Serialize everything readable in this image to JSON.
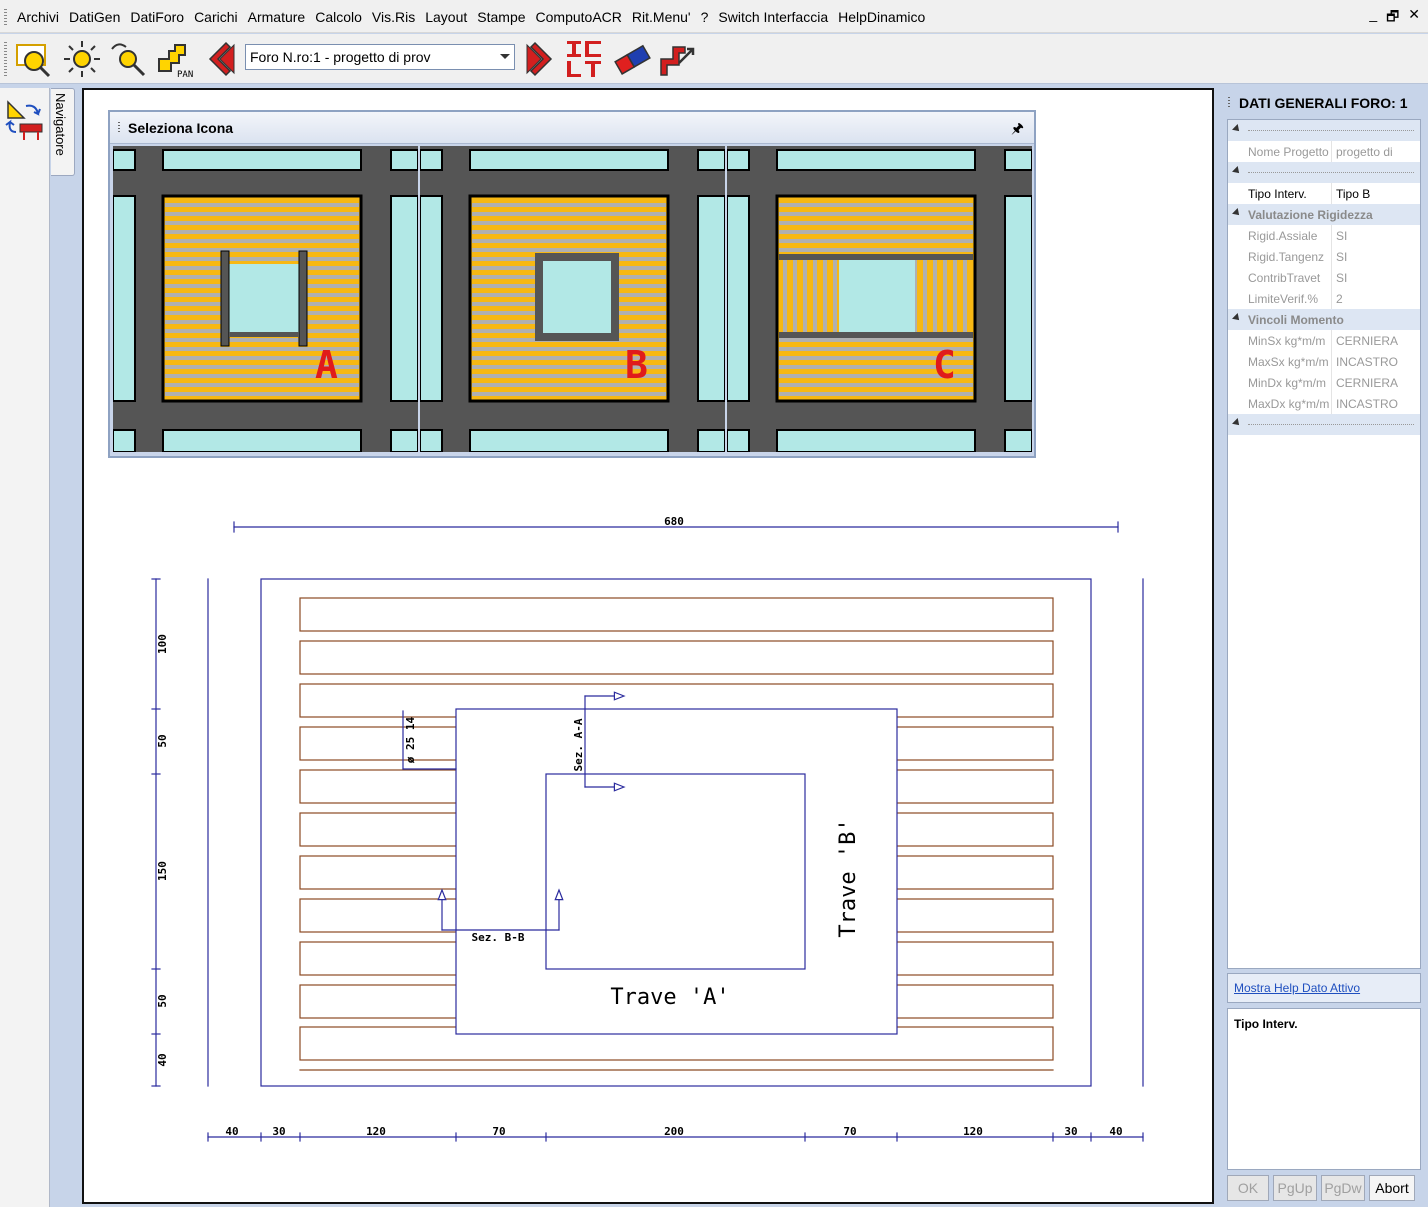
{
  "menu": [
    "Archivi",
    "DatiGen",
    "DatiForo",
    "Carichi",
    "Armature",
    "Calcolo",
    "Vis.Ris",
    "Layout",
    "Stampe",
    "ComputoACR",
    "Rit.Menu'",
    "?",
    "Switch Interfaccia",
    "HelpDinamico"
  ],
  "window_controls": {
    "minimize": "_",
    "restore": "🗗",
    "close": "✕"
  },
  "toolbar": {
    "combo_value": "Foro N.ro:1 - progetto di prov",
    "icons": [
      "select-zoom-icon",
      "zoom-all-icon",
      "zoom-icon",
      "pan-icon",
      "previous-icon",
      "next-icon",
      "section-icon",
      "eraser-icon",
      "redraw-icon"
    ],
    "pan_label": "PAN"
  },
  "navigator_tab": "Navigatore",
  "icon_selector": {
    "title": "Seleziona Icona",
    "pin": "🖈",
    "options": [
      {
        "letter": "A"
      },
      {
        "letter": "B"
      },
      {
        "letter": "C"
      }
    ]
  },
  "drawing": {
    "overall_dim": "680",
    "section_a": "Sez. A-A",
    "section_b": "Sez. B-B",
    "beam_a": "Trave 'A'",
    "beam_b": "Trave 'B'",
    "bar_label": "ø 25 14",
    "vertical_dims": [
      "100",
      "50",
      "150",
      "50",
      "40"
    ],
    "horizontal_dims": [
      "40",
      "30",
      "120",
      "70",
      "200",
      "70",
      "120",
      "30",
      "40"
    ]
  },
  "properties": {
    "title": "DATI GENERALI FORO: 1",
    "rows": [
      {
        "type": "sep"
      },
      {
        "type": "prop",
        "key": "Nome Progetto",
        "value": "progetto di"
      },
      {
        "type": "sep"
      },
      {
        "type": "prop",
        "key": "Tipo Interv.",
        "value": "Tipo B",
        "active": true
      },
      {
        "type": "cat",
        "label": "Valutazione Rigidezza"
      },
      {
        "type": "prop",
        "key": "Rigid.Assiale",
        "value": "SI"
      },
      {
        "type": "prop",
        "key": "Rigid.Tangenz",
        "value": "SI"
      },
      {
        "type": "prop",
        "key": "ContribTravet",
        "value": "SI"
      },
      {
        "type": "prop",
        "key": "LimiteVerif.%",
        "value": "2"
      },
      {
        "type": "cat",
        "label": "Vincoli Momento"
      },
      {
        "type": "prop",
        "key": "MinSx kg*m/m",
        "value": "CERNIERA"
      },
      {
        "type": "prop",
        "key": "MaxSx kg*m/m",
        "value": "INCASTRO"
      },
      {
        "type": "prop",
        "key": "MinDx kg*m/m",
        "value": "CERNIERA"
      },
      {
        "type": "prop",
        "key": "MaxDx kg*m/m",
        "value": "INCASTRO"
      },
      {
        "type": "sep"
      }
    ],
    "help_link": "Mostra Help Dato Attivo",
    "help_title": "Tipo Interv.",
    "buttons": [
      {
        "label": "OK",
        "enabled": false
      },
      {
        "label": "PgUp",
        "enabled": false
      },
      {
        "label": "PgDw",
        "enabled": false
      },
      {
        "label": "Abort",
        "enabled": true
      }
    ]
  },
  "colors": {
    "dark": "#555555",
    "cyan": "#b2e8e6",
    "orange": "#f7b813",
    "grey": "#b0b0b0",
    "blue_line": "#2b2b9e",
    "brown_line": "#8b4a23",
    "red": "#e01b1b"
  }
}
